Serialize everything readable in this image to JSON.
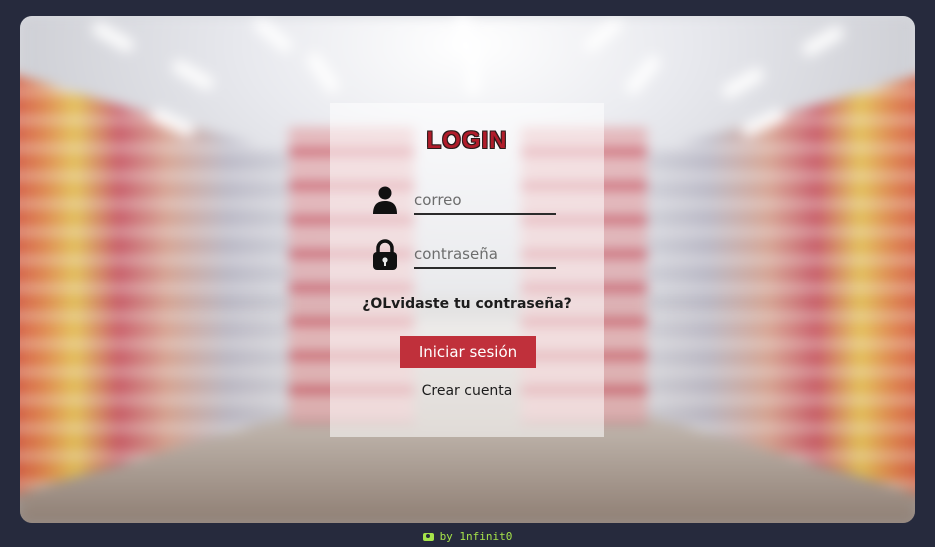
{
  "login": {
    "title": "LOGIN",
    "email_placeholder": "correo",
    "password_placeholder": "contraseña",
    "forgot_link": "¿OLvidaste tu contraseña?",
    "submit_label": "Iniciar sesión",
    "create_account_link": "Crear cuenta"
  },
  "footer": {
    "credit": "by 1nfinit0",
    "icon": "camera-icon"
  },
  "icons": {
    "email": "user-icon",
    "password": "lock-icon"
  },
  "colors": {
    "page_background": "#262a3d",
    "accent": "#c0303b",
    "title": "#b01c2a",
    "credit": "#a6e34a"
  }
}
